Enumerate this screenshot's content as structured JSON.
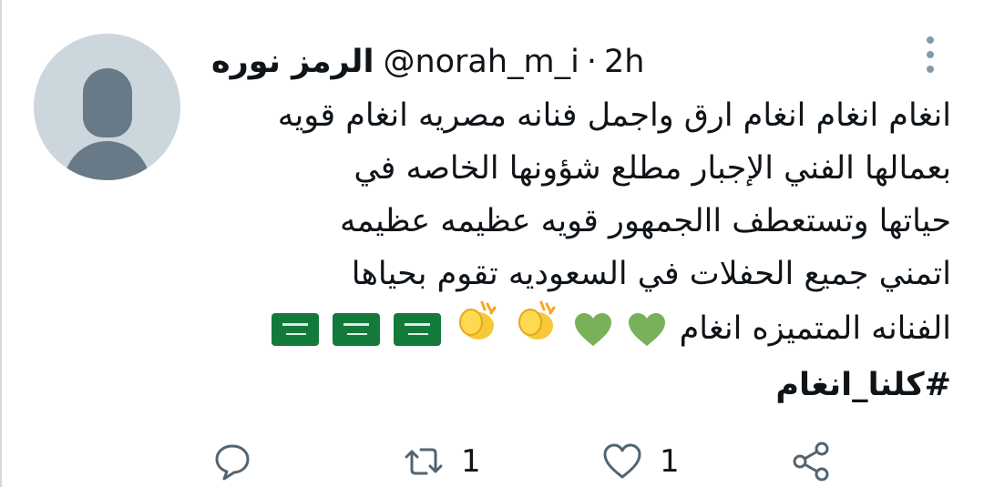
{
  "tweet": {
    "display_name": "الرمز نوره",
    "handle": "@norah_m_i",
    "separator": "·",
    "time": "2h",
    "lines": [
      "انغام انغام انغام ارق واجمل فنانه مصريه انغام قويه",
      "بعمالها الفني الإجبار مطلع شؤونها الخاصه في",
      "حياتها وتستعطف االجمهور قويه عظيمه عظيمه",
      "اتمني جميع الحفلات في السعوديه تقوم بحياها",
      "الفنانه المتميزه انغام"
    ],
    "emojis": [
      "green-heart",
      "green-heart",
      "clapping-hands",
      "clapping-hands",
      "saudi-flag",
      "saudi-flag",
      "saudi-flag"
    ],
    "hashtag": "#كلنا_انغام"
  },
  "actions": {
    "reply_count": "",
    "retweet_count": "1",
    "like_count": "1"
  },
  "colors": {
    "text": "#0f1419",
    "icon": "#536471",
    "avatar_bg": "#ccd6dd",
    "avatar_fg": "#687a87",
    "heart_green": "#78b159",
    "flag_green": "#147a3c"
  }
}
